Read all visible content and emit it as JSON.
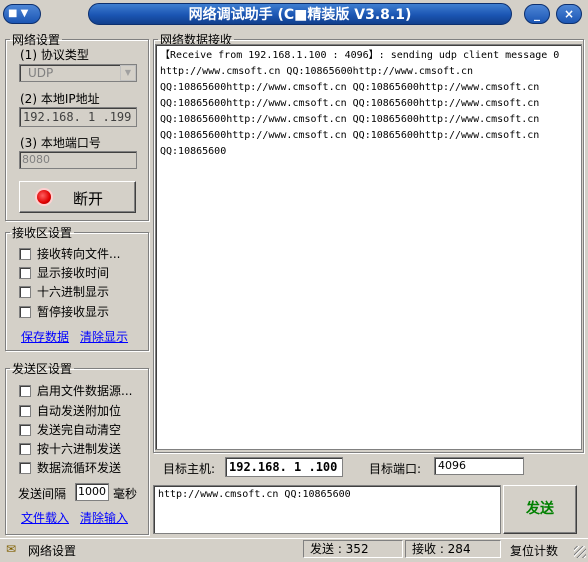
{
  "window": {
    "title": "网络调试助手 (C■精装版 V3.8.1)",
    "sys_menu_arrow": "▼",
    "minimize": "_",
    "close": "×"
  },
  "network_settings": {
    "legend": "网络设置",
    "protocol_label": "(1) 协议类型",
    "protocol_value": "UDP",
    "ip_label": "(2) 本地IP地址",
    "ip_value": "192.168. 1 .199",
    "port_label": "(3) 本地端口号",
    "port_value": "8080",
    "disconnect_label": "断开"
  },
  "receive_settings": {
    "legend": "接收区设置",
    "options": [
      "接收转向文件...",
      "显示接收时间",
      "十六进制显示",
      "暂停接收显示"
    ],
    "save_link": "保存数据",
    "clear_link": "清除显示"
  },
  "send_settings": {
    "legend": "发送区设置",
    "options": [
      "启用文件数据源...",
      "自动发送附加位",
      "发送完自动清空",
      "按十六进制发送",
      "数据流循环发送"
    ],
    "interval_label": "发送间隔",
    "interval_value": "1000",
    "interval_unit": "毫秒",
    "load_link": "文件载入",
    "clear_link": "清除输入"
  },
  "receive_area": {
    "legend": "网络数据接收",
    "lines": [
      "【Receive from 192.168.1.100 : 4096】: sending udp client message 0",
      "http://www.cmsoft.cn QQ:10865600http://www.cmsoft.cn",
      "QQ:10865600http://www.cmsoft.cn QQ:10865600http://www.cmsoft.cn",
      "QQ:10865600http://www.cmsoft.cn QQ:10865600http://www.cmsoft.cn",
      "QQ:10865600http://www.cmsoft.cn QQ:10865600http://www.cmsoft.cn",
      "QQ:10865600http://www.cmsoft.cn QQ:10865600http://www.cmsoft.cn",
      "QQ:10865600"
    ]
  },
  "target": {
    "host_label": "目标主机:",
    "host_value": "192.168. 1 .100",
    "port_label": "目标端口:",
    "port_value": "4096"
  },
  "send_area": {
    "text": "http://www.cmsoft.cn QQ:10865600",
    "send_button": "发送"
  },
  "status": {
    "mode": "网络设置",
    "sent": "发送 : 352",
    "received": "接收 : 284",
    "reset": "复位计数"
  },
  "colors": {
    "title_blue": "#1b55b3",
    "link": "#0000ff",
    "send_text": "#008000",
    "indicator": "#e00000"
  }
}
